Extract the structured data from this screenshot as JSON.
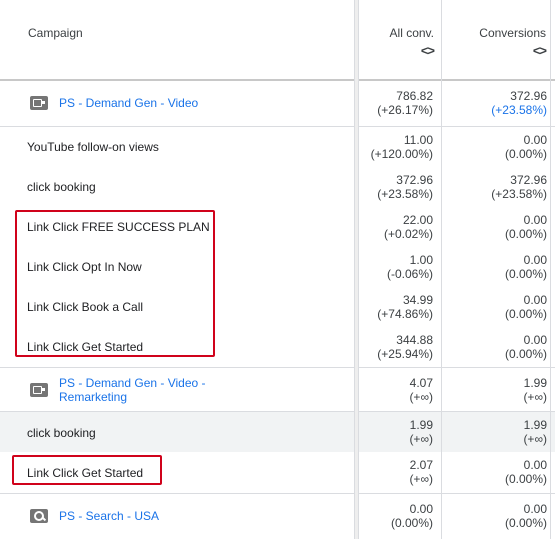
{
  "header": {
    "campaign_label": "Campaign",
    "all_conv_label": "All conv.",
    "conversions_label": "Conversions",
    "sort_glyph": "<>"
  },
  "rows": [
    {
      "name": "PS - Demand Gen - Video",
      "name2": "",
      "kind": "campaign",
      "icon": "video-campaign-icon",
      "all_conv": "786.82",
      "all_conv_pct": "(+26.17%)",
      "conv": "372.96",
      "conv_pct": "(+23.58%)"
    },
    {
      "name": "YouTube follow-on views",
      "kind": "action",
      "all_conv": "11.00",
      "all_conv_pct": "(+120.00%)",
      "conv": "0.00",
      "conv_pct": "(0.00%)"
    },
    {
      "name": "click booking",
      "kind": "action",
      "all_conv": "372.96",
      "all_conv_pct": "(+23.58%)",
      "conv": "372.96",
      "conv_pct": "(+23.58%)"
    },
    {
      "name": "Link Click FREE SUCCESS PLAN",
      "kind": "action",
      "all_conv": "22.00",
      "all_conv_pct": "(+0.02%)",
      "conv": "0.00",
      "conv_pct": "(0.00%)"
    },
    {
      "name": "Link Click Opt In Now",
      "kind": "action",
      "all_conv": "1.00",
      "all_conv_pct": "(-0.06%)",
      "conv": "0.00",
      "conv_pct": "(0.00%)"
    },
    {
      "name": "Link Click Book a Call",
      "kind": "action",
      "all_conv": "34.99",
      "all_conv_pct": "(+74.86%)",
      "conv": "0.00",
      "conv_pct": "(0.00%)"
    },
    {
      "name": "Link Click Get Started",
      "kind": "action",
      "all_conv": "344.88",
      "all_conv_pct": "(+25.94%)",
      "conv": "0.00",
      "conv_pct": "(0.00%)"
    },
    {
      "name": "PS - Demand Gen - Video -",
      "name2": "Remarketing",
      "kind": "campaign",
      "icon": "video-campaign-icon",
      "all_conv": "4.07",
      "all_conv_pct": "(+∞)",
      "conv": "1.99",
      "conv_pct": "(+∞)"
    },
    {
      "name": "click booking",
      "kind": "action",
      "all_conv": "1.99",
      "all_conv_pct": "(+∞)",
      "conv": "1.99",
      "conv_pct": "(+∞)"
    },
    {
      "name": "Link Click Get Started",
      "kind": "action",
      "all_conv": "2.07",
      "all_conv_pct": "(+∞)",
      "conv": "0.00",
      "conv_pct": "(0.00%)"
    },
    {
      "name": "PS - Search - USA",
      "kind": "campaign",
      "icon": "search-campaign-icon",
      "all_conv": "0.00",
      "all_conv_pct": "(0.00%)",
      "conv": "0.00",
      "conv_pct": "(0.00%)"
    }
  ],
  "colors": {
    "link": "#1a73e8",
    "highlight_box": "#d0021b",
    "shaded_row": "#f1f3f4"
  }
}
